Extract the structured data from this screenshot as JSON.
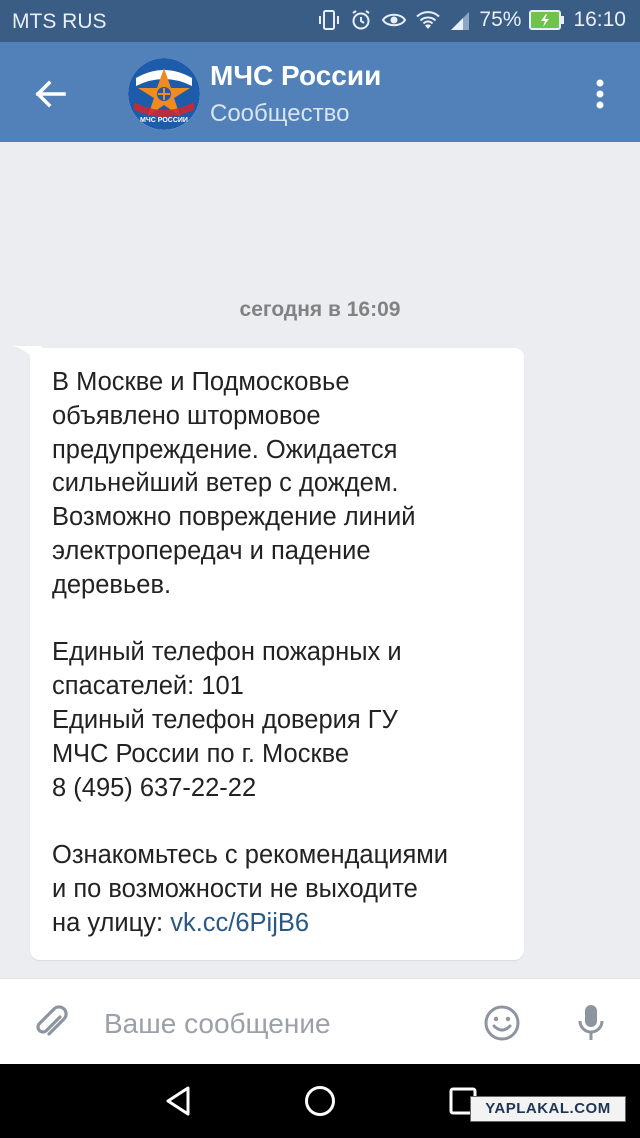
{
  "status_bar": {
    "carrier": "MTS RUS",
    "battery_percent": "75%",
    "time": "16:10",
    "icons": [
      "vibrate-icon",
      "alarm-icon",
      "eye-icon",
      "wifi-icon",
      "signal-icon",
      "battery-icon"
    ]
  },
  "header": {
    "title": "МЧС России",
    "subtitle": "Сообщество",
    "avatar_caption": "МЧС РОССИИ",
    "colors": {
      "bar": "#5181b8",
      "status": "#3a5d86"
    }
  },
  "chat": {
    "date_separator": "сегодня в 16:09",
    "message": {
      "text": "В Москве и Подмосковье\nобъявлено штормовое\nпредупреждение. Ожидается\nсильнейший ветер с дождем.\nВозможно повреждение линий\nэлектропередач и падение\nдеревьев.\n\nЕдиный телефон пожарных и\nспасателей: 101\nЕдиный телефон доверия ГУ\nМЧС России по г. Москве\n8 (495) 637-22-22\n\nОзнакомьтесь с рекомендациями\nи по возможности не выходите\nна улицу: ",
      "link": "vk.cc/6PijB6"
    }
  },
  "composer": {
    "placeholder": "Ваше сообщение"
  },
  "watermark": "YAPLAKAL.COM"
}
